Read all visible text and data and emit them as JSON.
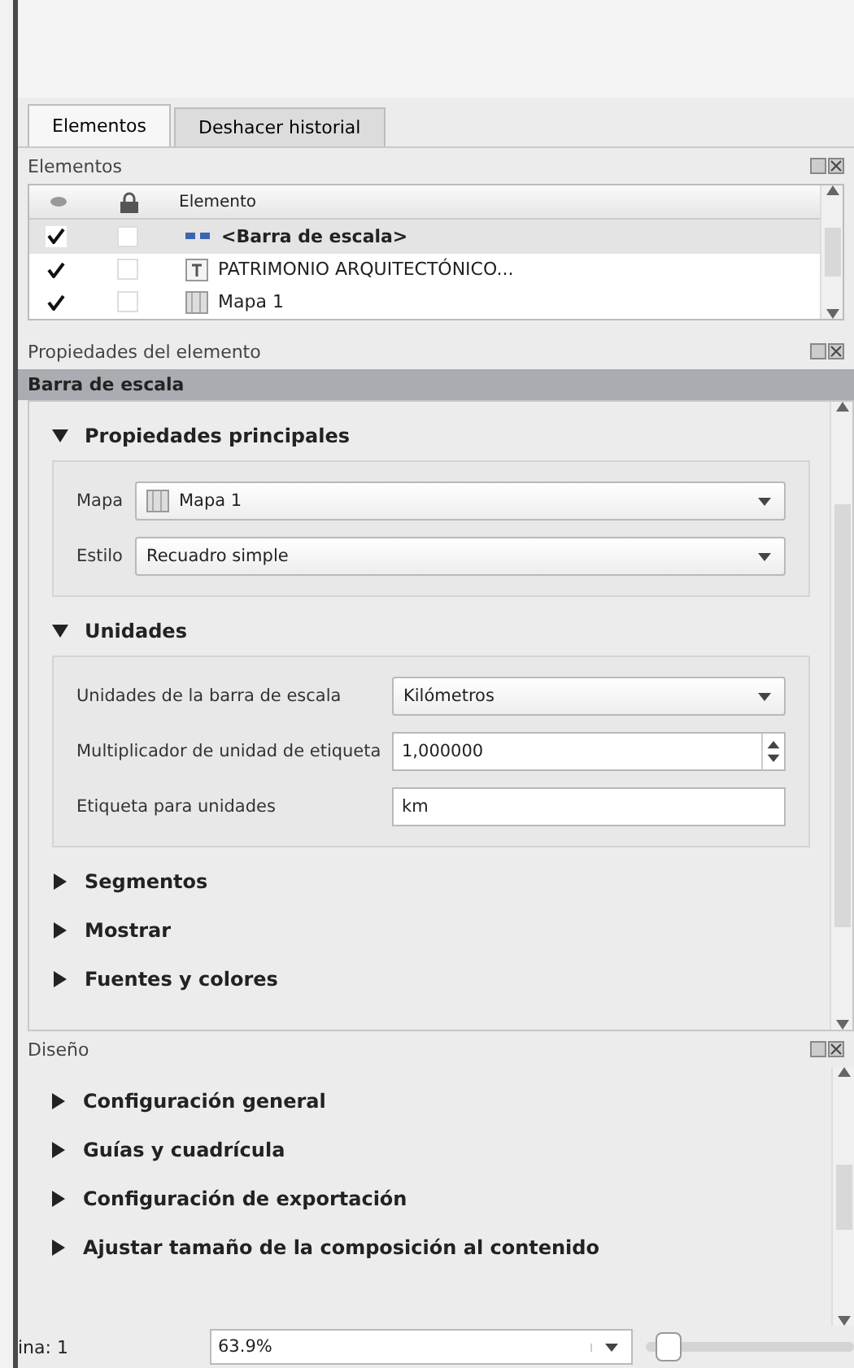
{
  "tabs": [
    {
      "label": "Elementos",
      "selected": true
    },
    {
      "label": "Deshacer historial",
      "selected": false
    }
  ],
  "items_panel": {
    "title": "Elementos",
    "columns": [
      "Elemento"
    ],
    "rows": [
      {
        "visible": true,
        "locked": false,
        "selected": true,
        "kind": "scalebar",
        "name": "<Barra de escala>"
      },
      {
        "visible": true,
        "locked": false,
        "selected": false,
        "kind": "label",
        "name": "PATRIMONIO ARQUITECTÓNICO..."
      },
      {
        "visible": true,
        "locked": false,
        "selected": false,
        "kind": "map",
        "name": "Mapa 1"
      }
    ]
  },
  "properties_panel": {
    "title": "Propiedades del elemento",
    "header": "Barra de escala",
    "sections": [
      {
        "title": "Propiedades principales",
        "expanded": true,
        "fields": [
          {
            "kind": "combo",
            "label": "Mapa",
            "value": "Mapa 1",
            "map_icon": true
          },
          {
            "kind": "combo",
            "label": "Estilo",
            "value": "Recuadro simple"
          }
        ]
      },
      {
        "title": "Unidades",
        "expanded": true,
        "fields": [
          {
            "kind": "combo",
            "label": "Unidades de la barra de escala",
            "value": "Kilómetros"
          },
          {
            "kind": "spin",
            "label": "Multiplicador de unidad de etiqueta",
            "value": "1,000000"
          },
          {
            "kind": "text",
            "label": "Etiqueta para unidades",
            "value": "km"
          }
        ]
      },
      {
        "title": "Segmentos",
        "expanded": false
      },
      {
        "title": "Mostrar",
        "expanded": false
      },
      {
        "title": "Fuentes y colores",
        "expanded": false
      }
    ]
  },
  "design_panel": {
    "title": "Diseño",
    "sections": [
      {
        "title": "Configuración general",
        "expanded": false
      },
      {
        "title": "Guías y cuadrícula",
        "expanded": false
      },
      {
        "title": "Configuración de exportación",
        "expanded": false
      },
      {
        "title": "Ajustar tamaño de la composición al contenido",
        "expanded": false
      }
    ]
  },
  "status_bar": {
    "page": "ina: 1",
    "zoom": "63.9%",
    "zoom_slider": {
      "level": 0.05
    }
  }
}
